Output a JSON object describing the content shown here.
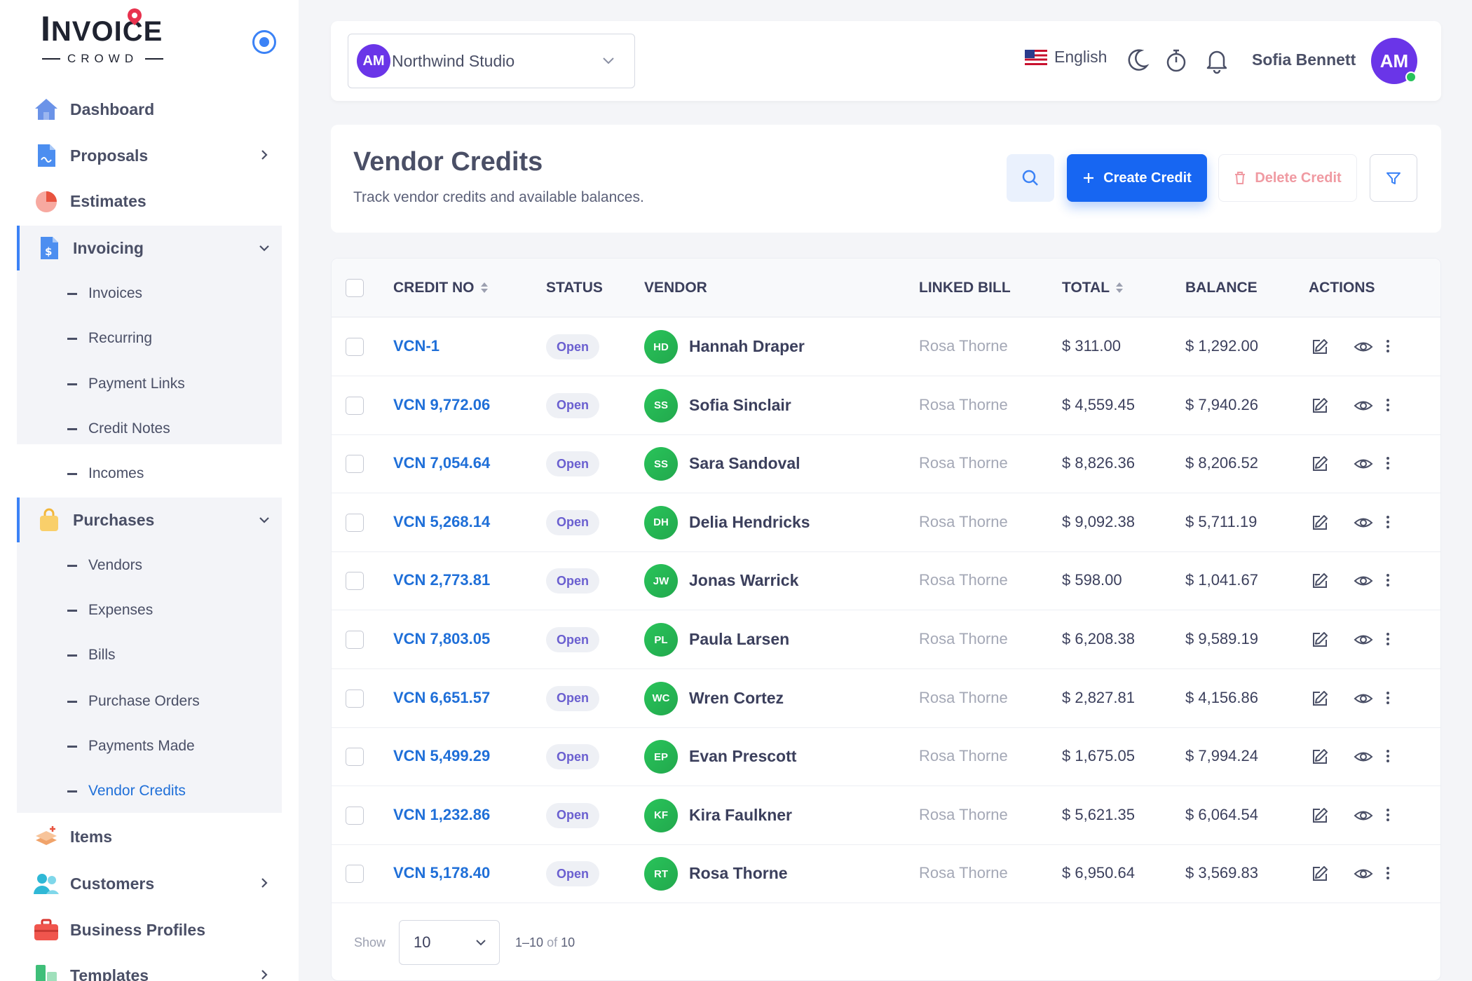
{
  "brand": {
    "name_first": "I",
    "name_rest": "NVOICE",
    "sub": "CROWD"
  },
  "sidebar": {
    "items": [
      {
        "label": "Dashboard",
        "icon": "home-icon"
      },
      {
        "label": "Proposals",
        "icon": "document-icon"
      },
      {
        "label": "Estimates",
        "icon": "pie-chart-icon"
      },
      {
        "label": "Invoicing",
        "icon": "invoice-icon"
      },
      {
        "label": "Purchases",
        "icon": "shopping-bag-icon"
      },
      {
        "label": "Items",
        "icon": "boxes-icon"
      },
      {
        "label": "Customers",
        "icon": "users-icon"
      },
      {
        "label": "Business Profiles",
        "icon": "briefcase-icon"
      },
      {
        "label": "Templates",
        "icon": "templates-icon"
      }
    ],
    "invoicing_sub": [
      "Invoices",
      "Recurring",
      "Payment Links",
      "Credit Notes",
      "Incomes"
    ],
    "purchases_sub": [
      "Vendors",
      "Expenses",
      "Bills",
      "Purchase Orders",
      "Payments Made",
      "Vendor Credits"
    ],
    "active_sub": "Vendor Credits"
  },
  "header": {
    "company_initials": "AM",
    "company_name": "Northwind Studio",
    "language": "English",
    "user_name": "Sofia Bennett",
    "user_initials": "AM"
  },
  "page": {
    "title": "Vendor Credits",
    "subtitle": "Track vendor credits and available balances.",
    "create_label": "Create Credit",
    "delete_label": "Delete Credit"
  },
  "table": {
    "columns": [
      "CREDIT NO",
      "STATUS",
      "VENDOR",
      "LINKED BILL",
      "TOTAL",
      "BALANCE",
      "ACTIONS"
    ],
    "rows": [
      {
        "credit_no": "VCN-1",
        "status": "Open",
        "initials": "HD",
        "vendor": "Hannah Draper",
        "linked_bill": "Rosa Thorne",
        "total": "$ 311.00",
        "balance": "$ 1,292.00"
      },
      {
        "credit_no": "VCN 9,772.06",
        "status": "Open",
        "initials": "SS",
        "vendor": "Sofia Sinclair",
        "linked_bill": "Rosa Thorne",
        "total": "$ 4,559.45",
        "balance": "$ 7,940.26"
      },
      {
        "credit_no": "VCN 7,054.64",
        "status": "Open",
        "initials": "SS",
        "vendor": "Sara Sandoval",
        "linked_bill": "Rosa Thorne",
        "total": "$ 8,826.36",
        "balance": "$ 8,206.52"
      },
      {
        "credit_no": "VCN 5,268.14",
        "status": "Open",
        "initials": "DH",
        "vendor": "Delia Hendricks",
        "linked_bill": "Rosa Thorne",
        "total": "$ 9,092.38",
        "balance": "$ 5,711.19"
      },
      {
        "credit_no": "VCN 2,773.81",
        "status": "Open",
        "initials": "JW",
        "vendor": "Jonas Warrick",
        "linked_bill": "Rosa Thorne",
        "total": "$ 598.00",
        "balance": "$ 1,041.67"
      },
      {
        "credit_no": "VCN 7,803.05",
        "status": "Open",
        "initials": "PL",
        "vendor": "Paula Larsen",
        "linked_bill": "Rosa Thorne",
        "total": "$ 6,208.38",
        "balance": "$ 9,589.19"
      },
      {
        "credit_no": "VCN 6,651.57",
        "status": "Open",
        "initials": "WC",
        "vendor": "Wren Cortez",
        "linked_bill": "Rosa Thorne",
        "total": "$ 2,827.81",
        "balance": "$ 4,156.86"
      },
      {
        "credit_no": "VCN 5,499.29",
        "status": "Open",
        "initials": "EP",
        "vendor": "Evan Prescott",
        "linked_bill": "Rosa Thorne",
        "total": "$ 1,675.05",
        "balance": "$ 7,994.24"
      },
      {
        "credit_no": "VCN 1,232.86",
        "status": "Open",
        "initials": "KF",
        "vendor": "Kira Faulkner",
        "linked_bill": "Rosa Thorne",
        "total": "$ 5,621.35",
        "balance": "$ 6,064.54"
      },
      {
        "credit_no": "VCN 5,178.40",
        "status": "Open",
        "initials": "RT",
        "vendor": "Rosa Thorne",
        "linked_bill": "Rosa Thorne",
        "total": "$ 6,950.64",
        "balance": "$ 3,569.83"
      }
    ]
  },
  "pagination": {
    "show_label": "Show",
    "page_size": "10",
    "range": "1–10",
    "of_label": "of",
    "total": "10"
  },
  "colors": {
    "accent": "#1766f2",
    "link": "#1f6fd8",
    "avatar_purple": "#6a35e8",
    "vendor_green": "#29c45a",
    "delete": "#f09aa2"
  }
}
